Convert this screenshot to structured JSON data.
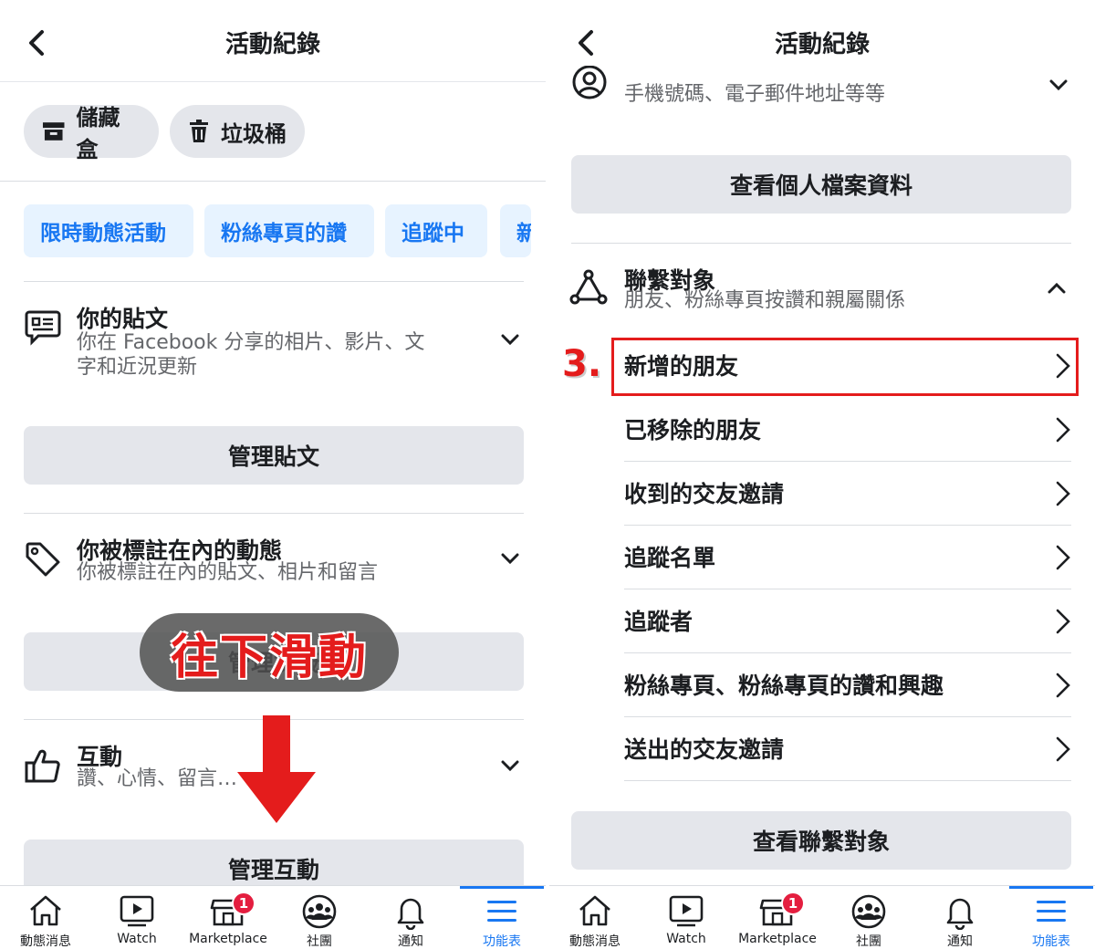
{
  "left": {
    "header": {
      "title": "活動紀錄"
    },
    "pills": {
      "archive": "儲藏盒",
      "trash": "垃圾桶"
    },
    "chips": [
      "限時動態活動",
      "粉絲專頁的讚",
      "追蹤中",
      "新"
    ],
    "posts": {
      "title": "你的貼文",
      "subtitle_line1": "你在 Facebook 分享的相片、影片、文",
      "subtitle_line2": "字和近況更新",
      "button": "管理貼文"
    },
    "tagged": {
      "title": "你被標註在內的動態",
      "subtitle": "你被標註在內的貼文、相片和留言",
      "button": "管理標籤"
    },
    "interactions": {
      "title": "互動",
      "subtitle": "讚、心情、留言…",
      "button": "管理互動"
    },
    "overlay": {
      "text": "往下滑動"
    }
  },
  "right": {
    "header": {
      "title": "活動紀錄"
    },
    "top_partial": {
      "subtitle": "手機號碼、電子郵件地址等等",
      "button": "查看個人檔案資料"
    },
    "connections": {
      "title": "聯繫對象",
      "subtitle": "朋友、粉絲專頁按讚和親屬關係",
      "items": [
        "新增的朋友",
        "已移除的朋友",
        "收到的交友邀請",
        "追蹤名單",
        "追蹤者",
        "粉絲專頁、粉絲專頁的讚和興趣",
        "送出的交友邀請"
      ],
      "button": "查看聯繫對象"
    },
    "step": {
      "label": "3."
    }
  },
  "tabbar": {
    "tabs": [
      {
        "label": "動態消息",
        "icon": "home-icon"
      },
      {
        "label": "Watch",
        "icon": "watch-icon"
      },
      {
        "label": "Marketplace",
        "icon": "marketplace-icon",
        "badge": "1"
      },
      {
        "label": "社團",
        "icon": "groups-icon"
      },
      {
        "label": "通知",
        "icon": "bell-icon"
      },
      {
        "label": "功能表",
        "icon": "menu-icon",
        "active": true
      }
    ]
  },
  "colors": {
    "accent": "#1877f2",
    "highlight": "#e41c1c",
    "badge": "#e41e3f"
  }
}
